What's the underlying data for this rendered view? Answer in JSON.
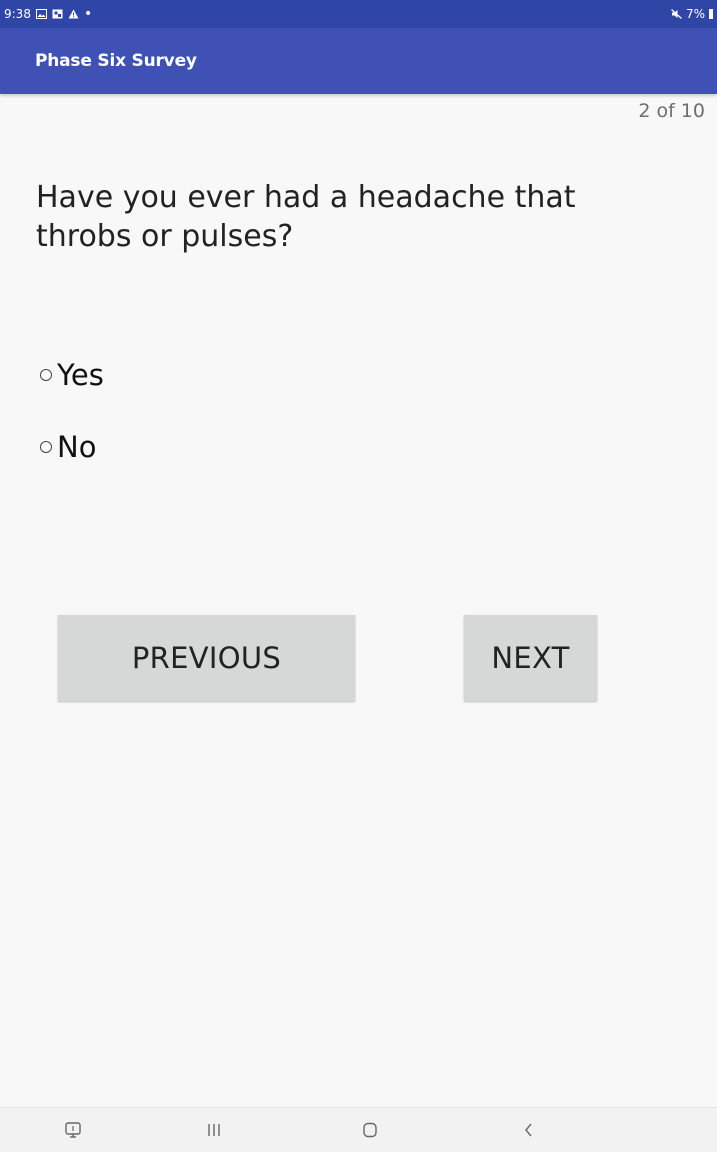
{
  "status_bar": {
    "time": "9:38",
    "battery": "7%"
  },
  "app_bar": {
    "title": "Phase Six Survey"
  },
  "survey": {
    "progress": "2 of 10",
    "question": "Have you ever had a headache that throbs or pulses?",
    "options": [
      {
        "label": "Yes",
        "selected": false
      },
      {
        "label": "No",
        "selected": false
      }
    ]
  },
  "buttons": {
    "previous_label": "PREVIOUS",
    "next_label": "NEXT"
  },
  "nav_bar": {
    "icons": [
      "screen-icon",
      "recents-icon",
      "home-icon",
      "back-icon"
    ]
  },
  "colors": {
    "status_bar": "#2f46a6",
    "app_bar": "#3f51b5",
    "background": "#f8f8f8",
    "button": "#d6d7d7"
  }
}
